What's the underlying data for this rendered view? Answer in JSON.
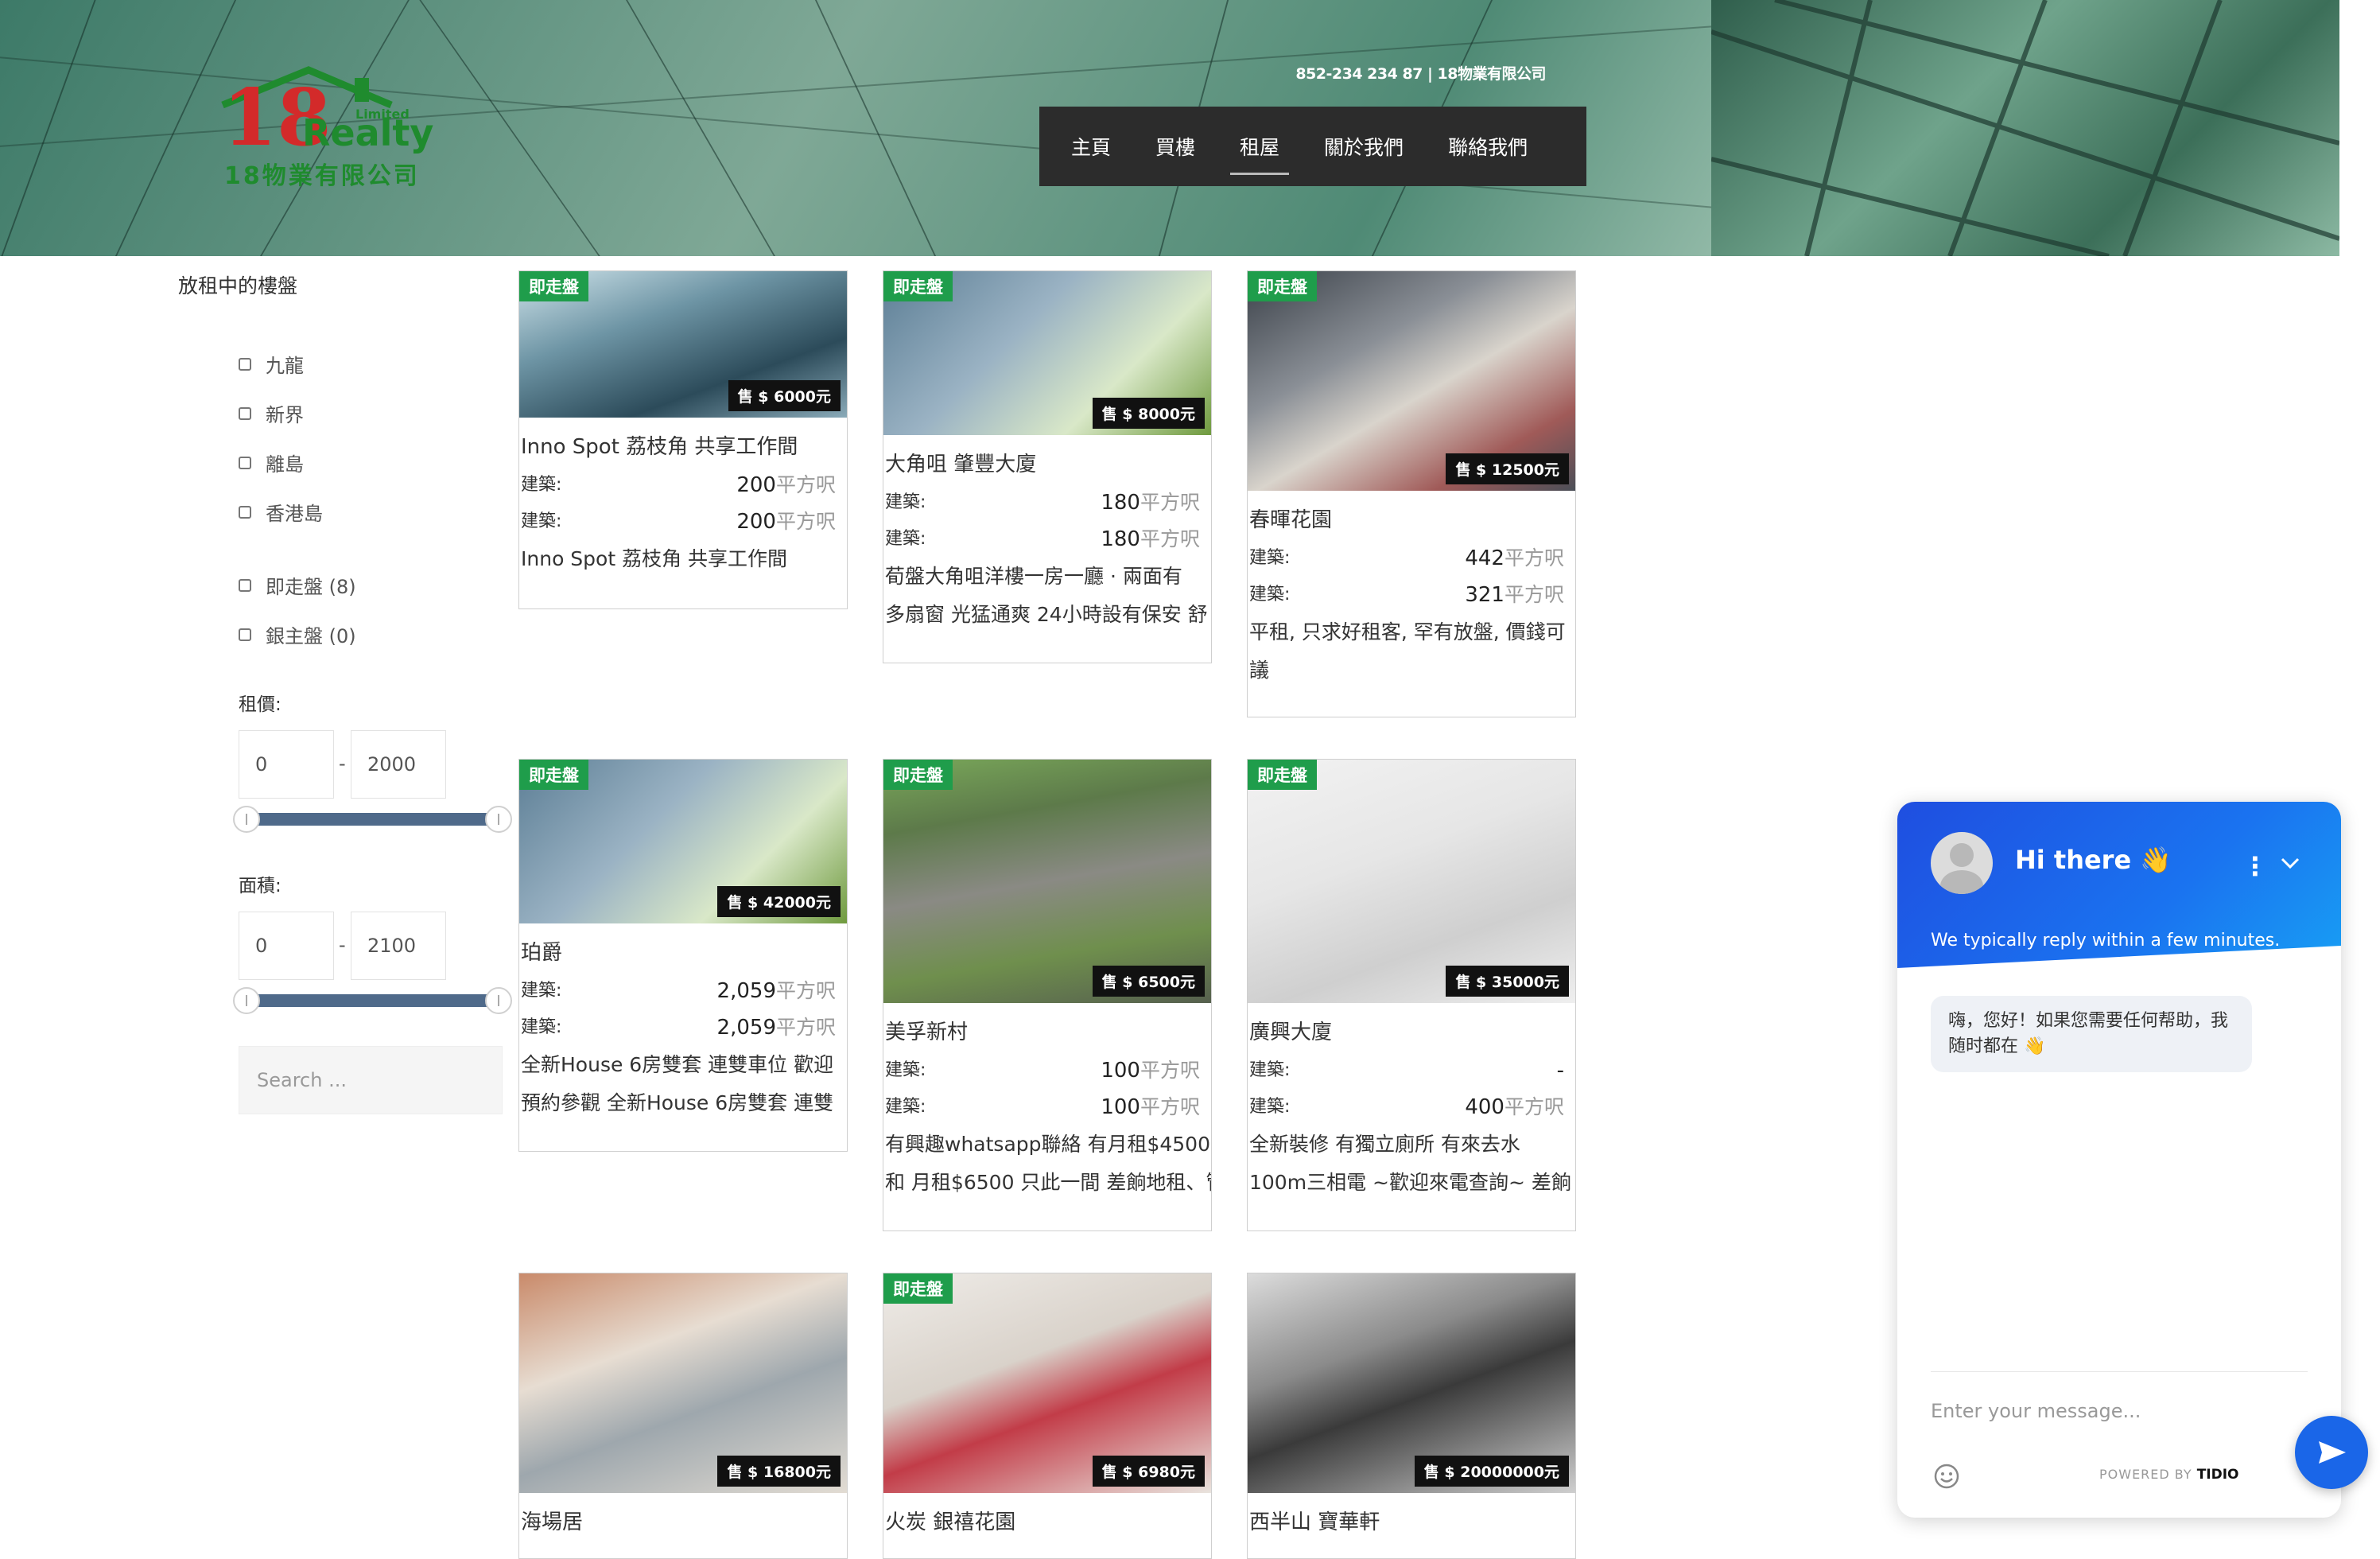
{
  "header": {
    "logo": {
      "number": "18",
      "word": "Realty",
      "limited": "Limited",
      "company": "18物業有限公司"
    },
    "contact": "852-234 234 87 | 18物業有限公司",
    "nav": [
      {
        "label": "主頁"
      },
      {
        "label": "買樓"
      },
      {
        "label": "租屋"
      },
      {
        "label": "關於我們"
      },
      {
        "label": "聯絡我們"
      }
    ],
    "active_nav": "租屋"
  },
  "sidebar": {
    "title": "放租中的樓盤",
    "regions": [
      "九龍",
      "新界",
      "離島",
      "香港島"
    ],
    "status_filters": [
      "即走盤 (8)",
      "銀主盤 (0)"
    ],
    "rent": {
      "label": "租價:",
      "min": "0",
      "max": "2000",
      "dash": "-"
    },
    "area": {
      "label": "面積:",
      "min": "0",
      "max": "2100",
      "dash": "-"
    },
    "search_placeholder": "Search ..."
  },
  "listings": [
    {
      "badge": "即走盤",
      "price": "售 $ 6000元",
      "title": "Inno Spot 荔枝角 共享工作間",
      "row1": {
        "label": "建築:",
        "value": "200",
        "unit": "平方呎"
      },
      "row2": {
        "label": "建築:",
        "value": "200",
        "unit": "平方呎"
      },
      "desc": [
        "Inno Spot 荔枝角 共享工作間"
      ]
    },
    {
      "badge": "即走盤",
      "price": "售 $ 8000元",
      "title": "大角咀 肇豐大廈",
      "row1": {
        "label": "建築:",
        "value": "180",
        "unit": "平方呎"
      },
      "row2": {
        "label": "建築:",
        "value": "180",
        "unit": "平方呎"
      },
      "desc": [
        "荀盤大角咀洋樓一房一廳 · 兩面有",
        "多扇窗 光猛通爽 24小時設有保安 舒"
      ]
    },
    {
      "badge": "即走盤",
      "price": "售 $ 12500元",
      "title": "春暉花園",
      "row1": {
        "label": "建築:",
        "value": "442",
        "unit": "平方呎"
      },
      "row2": {
        "label": "建築:",
        "value": "321",
        "unit": "平方呎"
      },
      "desc": [
        "平租, 只求好租客, 罕有放盤, 價錢可",
        "議"
      ]
    },
    {
      "badge": "即走盤",
      "price": "售 $ 42000元",
      "title": "珀爵",
      "row1": {
        "label": "建築:",
        "value": "2,059",
        "unit": "平方呎"
      },
      "row2": {
        "label": "建築:",
        "value": "2,059",
        "unit": "平方呎"
      },
      "desc": [
        "全新House 6房雙套 連雙車位 歡迎",
        "預約參觀 全新House 6房雙套 連雙"
      ]
    },
    {
      "badge": "即走盤",
      "price": "售 $ 6500元",
      "title": "美孚新村",
      "row1": {
        "label": "建築:",
        "value": "100",
        "unit": "平方呎"
      },
      "row2": {
        "label": "建築:",
        "value": "100",
        "unit": "平方呎"
      },
      "desc": [
        "有興趣whatsapp聯絡 有月租$4500",
        "和 月租$6500 只此一間 差餉地租、管"
      ]
    },
    {
      "badge": "即走盤",
      "price": "售 $ 35000元",
      "title": "廣興大廈",
      "row1": {
        "label": "建築:",
        "value": "-",
        "unit": ""
      },
      "row2": {
        "label": "建築:",
        "value": "400",
        "unit": "平方呎"
      },
      "desc": [
        "全新裝修 有獨立廁所 有來去水",
        "100m三相電 ~歡迎來電查詢~ 差餉"
      ]
    },
    {
      "badge": "",
      "price": "售 $ 16800元",
      "title": "海場居"
    },
    {
      "badge": "即走盤",
      "price": "售 $ 6980元",
      "title": "火炭 銀禧花園"
    },
    {
      "badge": "",
      "price": "售 $ 20000000元",
      "title": "西半山 寶華軒"
    }
  ],
  "chat": {
    "title": "Hi there 👋",
    "subtitle": "We typically reply within a few minutes.",
    "message": "嗨，您好！如果您需要任何帮助，我随时都在 👋",
    "input_placeholder": "Enter your message...",
    "powered_by": "POWERED BY",
    "brand": "TIDIO"
  },
  "colors": {
    "nav_bg": "#2c2c2c",
    "badge": "#1f9d4b",
    "slider": "#4f6a8a",
    "chat_blue": "#1a66e8"
  }
}
